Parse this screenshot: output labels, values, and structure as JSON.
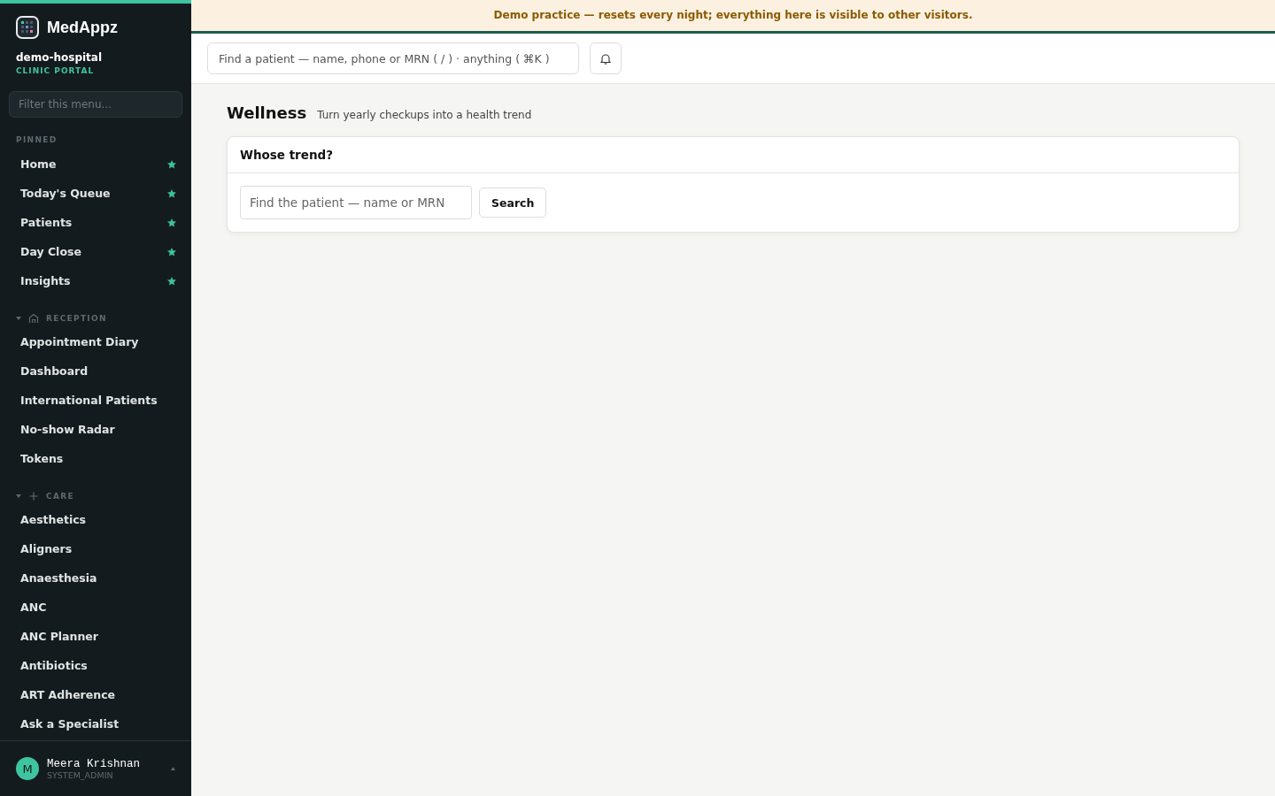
{
  "sidebar": {
    "brand": "MedAppz",
    "org": "demo-hospital",
    "portal": "CLINIC PORTAL",
    "filter": {
      "placeholder": "Filter this menu..."
    },
    "pinned": {
      "label": "PINNED",
      "items": [
        {
          "label": "Home",
          "pinned": true
        },
        {
          "label": "Today's Queue",
          "pinned": true
        },
        {
          "label": "Patients",
          "pinned": true
        },
        {
          "label": "Day Close",
          "pinned": true
        },
        {
          "label": "Insights",
          "pinned": true
        }
      ]
    },
    "sections": [
      {
        "label": "RECEPTION",
        "expanded": true,
        "items": [
          "Appointment Diary",
          "Dashboard",
          "International Patients",
          "No-show Radar",
          "Tokens"
        ]
      },
      {
        "label": "CARE",
        "expanded": true,
        "items": [
          "Aesthetics",
          "Aligners",
          "Anaesthesia",
          "ANC",
          "ANC Planner",
          "Antibiotics",
          "ART Adherence",
          "Ask a Specialist"
        ]
      }
    ],
    "user": {
      "initial": "M",
      "name": "Meera Krishnan",
      "role": "SYSTEM_ADMIN"
    }
  },
  "banner": "Demo practice — resets every night; everything here is visible to other visitors.",
  "topbar": {
    "search": {
      "placeholder": "Find a patient — name, phone or MRN ( / ) · anything ( ⌘K )"
    }
  },
  "page": {
    "title": "Wellness",
    "subtitle": "Turn yearly checkups into a health trend",
    "card": {
      "title": "Whose trend?",
      "search": {
        "placeholder": "Find the patient — name or MRN"
      },
      "button": "Search"
    }
  }
}
